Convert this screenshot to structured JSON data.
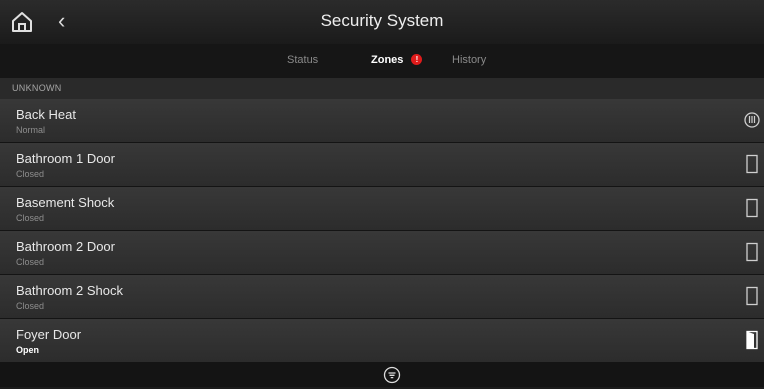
{
  "header": {
    "title": "Security System",
    "home_icon": "home-icon",
    "back_icon": "back-chevron-icon",
    "back_glyph": "‹"
  },
  "tabs": [
    {
      "label": "Status",
      "active": false
    },
    {
      "label": "Zones",
      "active": true,
      "badge": "!"
    },
    {
      "label": "History",
      "active": false
    }
  ],
  "section": {
    "label": "UNKNOWN"
  },
  "zones": [
    {
      "name": "Back Heat",
      "state": "Normal",
      "icon": "heat-sensor-icon"
    },
    {
      "name": "Bathroom 1 Door",
      "state": "Closed",
      "icon": "door-closed-icon"
    },
    {
      "name": "Basement Shock",
      "state": "Closed",
      "icon": "door-closed-icon"
    },
    {
      "name": "Bathroom 2 Door",
      "state": "Closed",
      "icon": "door-closed-icon"
    },
    {
      "name": "Bathroom 2 Shock",
      "state": "Closed",
      "icon": "door-closed-icon"
    },
    {
      "name": "Foyer Door",
      "state": "Open",
      "icon": "door-open-icon"
    }
  ],
  "footer": {
    "filter_icon": "filter-icon"
  },
  "colors": {
    "badge": "#e01b1b",
    "background": "#1c1c1c",
    "row": "#353535"
  }
}
